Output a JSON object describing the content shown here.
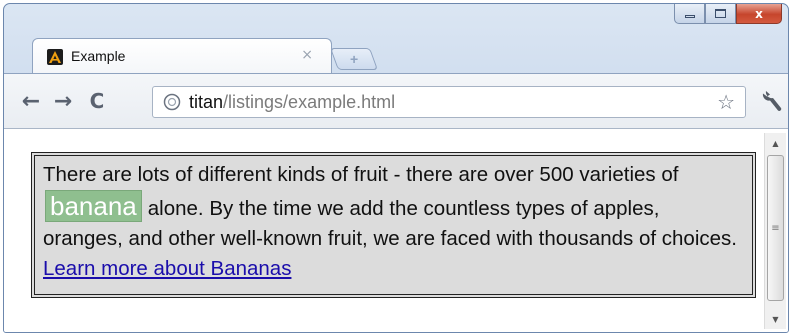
{
  "browser": {
    "tab": {
      "title": "Example",
      "close_glyph": "×",
      "favicon": "letter-a-icon"
    },
    "new_tab_glyph": "+",
    "window_controls": {
      "minimize": "minimize-icon",
      "maximize": "maximize-icon",
      "close_glyph": "x"
    },
    "toolbar": {
      "back_glyph": "←",
      "forward_glyph": "→",
      "reload_glyph": "C",
      "star_glyph": "☆"
    },
    "address": {
      "host": "titan",
      "path": "/listings/example.html"
    }
  },
  "page": {
    "sentence_1": "There are lots of different kinds of fruit - there are over 500 varieties of",
    "highlight": "banana",
    "sentence_2": "alone. By the time we add the countless types of apples, oranges, and other well-known fruit, we are faced with thousands of choices.",
    "link_text": "Learn more about Bananas"
  },
  "scrollbar": {
    "up_glyph": "▲",
    "down_glyph": "▼",
    "grip_glyph": "≡"
  },
  "colors": {
    "box_background": "#dcdcdc",
    "highlight_background": "#8fbf8f",
    "link": "#1a0dab"
  }
}
